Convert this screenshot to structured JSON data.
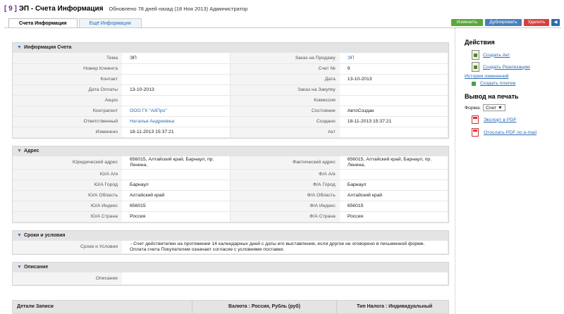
{
  "header": {
    "record_num": "[ 9 ]",
    "title": "ЭП - Счета Информация",
    "meta": "Обновлено 78 дней назад (18 Ноя 2013) Администратор"
  },
  "tabs": [
    "Счета Информация",
    "Ещё Информация"
  ],
  "actions": {
    "edit": "Изменить",
    "duplicate": "Дублировать",
    "delete": "Удалить",
    "back": "◀"
  },
  "info": {
    "title": "Информация Счета",
    "rows": [
      [
        "Тема",
        "ЭП",
        "Заказ на Продажу",
        "ЭП"
      ],
      [
        "Номер Клиента",
        "",
        "Счет №",
        "9"
      ],
      [
        "Контакт",
        "",
        "Дата",
        "13-10-2013"
      ],
      [
        "Дата Оплаты",
        "13-10-2013",
        "Заказ на Закупку",
        ""
      ],
      [
        "Акциз",
        "",
        "Комиссия",
        ""
      ],
      [
        "Контрагент",
        "ООО ГК \"АйПро\"",
        "Состояние",
        "АвтоСоздан"
      ],
      [
        "Ответственный",
        "Наталья Андреевна",
        "Создано",
        "18-11-2013 15:37:21"
      ],
      [
        "Изменено",
        "18-11-2013 15:37:21",
        "Акт",
        ""
      ]
    ]
  },
  "address": {
    "title": "Адрес",
    "rows": [
      [
        "Юридический адрес",
        "656015, Алтайский край, Барнаул, пр. Ленина,",
        "Фактический адрес",
        "656015, Алтайский край, Барнаул, пр. Ленина,"
      ],
      [
        "Ю/А А/я",
        "",
        "Ф/А А/я",
        ""
      ],
      [
        "Ю/А Город",
        "Барнаул",
        "Ф/А Город",
        "Барнаул"
      ],
      [
        "Ю/А Область",
        "Алтайский край",
        "Ф/А Область",
        "Алтайский край"
      ],
      [
        "Ю/А Индекс",
        "656015",
        "Ф/А Индекс",
        "656015"
      ],
      [
        "Ю/А Страна",
        "Россия",
        "Ф/А Страна",
        "Россия"
      ]
    ]
  },
  "terms": {
    "title": "Сроки и условия",
    "label": "Сроки и Условия",
    "value_line1": "- Счет действителен на протяжении 14 календарных дней с даты его выставления, если другое не оговорено в письменной форме.",
    "value_line2": "Оплата счета Покупателем означает согласие с условиями поставки."
  },
  "description": {
    "title": "Описание",
    "label": "Описание",
    "value": ""
  },
  "details": {
    "title": "Детали Записи",
    "currency": "Валюта : Россия, Рубль (руб)",
    "tax": "Тип Налога : Индивидуальный"
  },
  "sidebar": {
    "actions_title": "Действия",
    "create_act": "Создать Акт",
    "create_sale": "Создать Реализацию",
    "history": "История изменений",
    "create_payment": "Создать платеж",
    "print_title": "Вывод на печать",
    "form_label": "Форма:",
    "form_value": "Счет ▼",
    "export_pdf": "Экспорт в PDF",
    "send_pdf": "Отослать PDF по e-mail"
  }
}
